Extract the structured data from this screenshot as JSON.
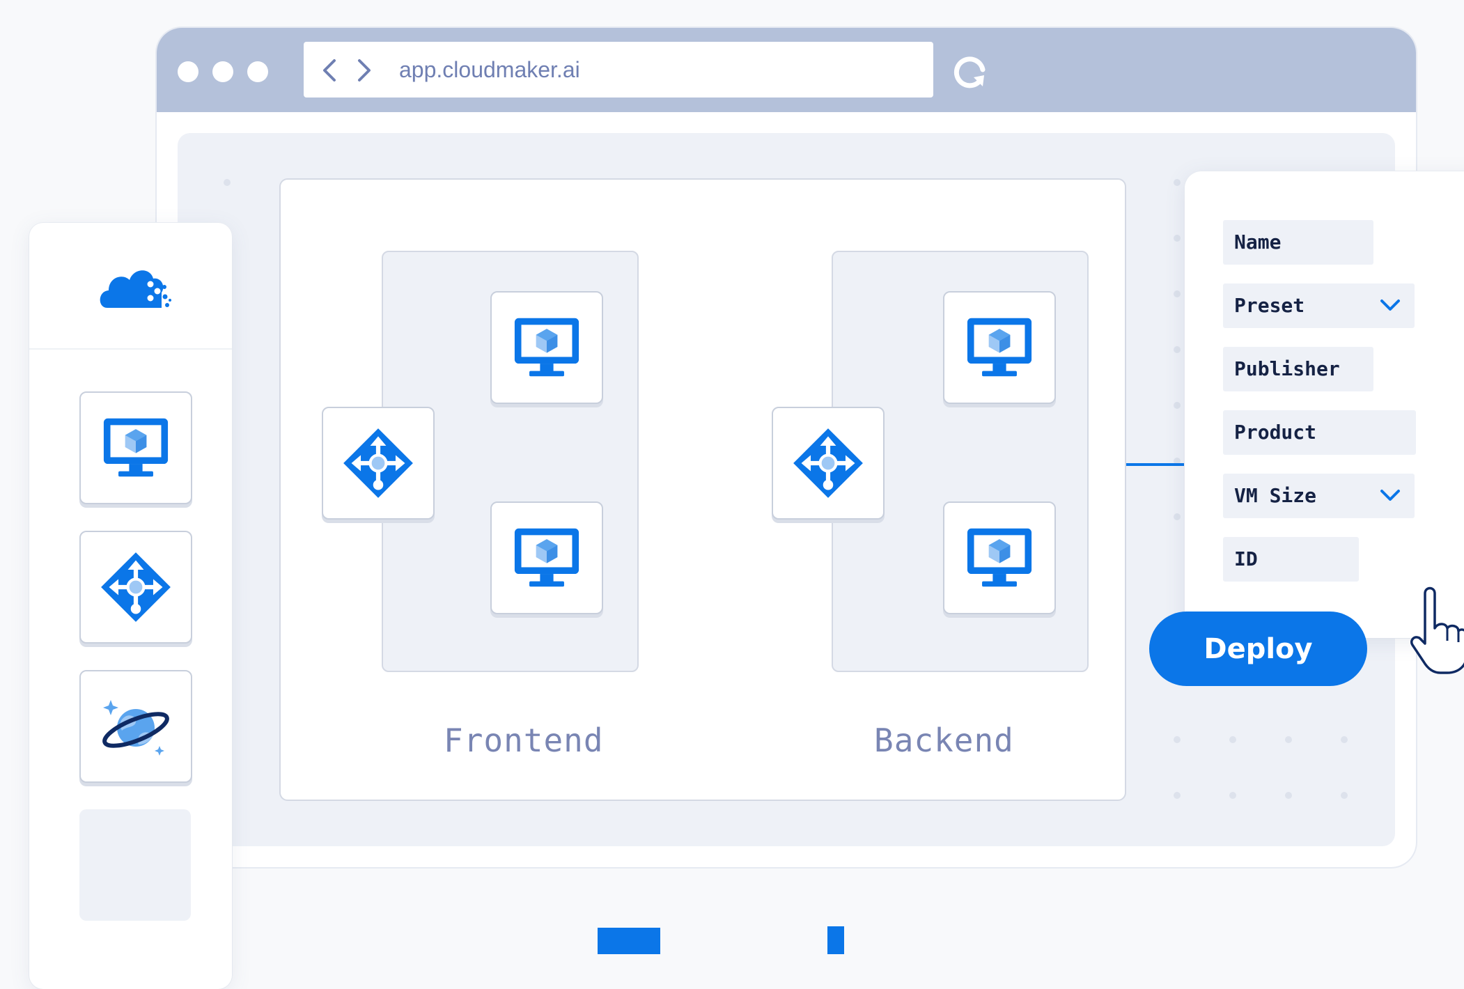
{
  "browser": {
    "url": "app.cloudmaker.ai",
    "nav_back_icon": "chevron-left-icon",
    "nav_forward_icon": "chevron-right-icon",
    "reload_icon": "reload-icon"
  },
  "sidebar": {
    "logo_icon": "cloud-logo-icon",
    "items": [
      {
        "icon": "virtual-machine-icon"
      },
      {
        "icon": "load-balancer-icon"
      },
      {
        "icon": "cosmos-db-icon"
      },
      {
        "icon": "empty-slot"
      }
    ]
  },
  "diagram": {
    "groups": [
      {
        "label": "Frontend",
        "nodes": [
          "load-balancer-icon",
          "virtual-machine-icon",
          "virtual-machine-icon"
        ]
      },
      {
        "label": "Backend",
        "nodes": [
          "load-balancer-icon",
          "virtual-machine-icon",
          "virtual-machine-icon"
        ]
      }
    ]
  },
  "properties": {
    "fields": [
      {
        "label": "Name",
        "dropdown": false
      },
      {
        "label": "Preset",
        "dropdown": true
      },
      {
        "label": "Publisher",
        "dropdown": false
      },
      {
        "label": "Product",
        "dropdown": false
      },
      {
        "label": "VM Size",
        "dropdown": true
      },
      {
        "label": "ID",
        "dropdown": false
      }
    ]
  },
  "deploy_label": "Deploy",
  "colors": {
    "accent": "#0b76e8",
    "titlebar": "#b4c1da",
    "canvas": "#eef1f7",
    "label": "#7985b3"
  }
}
